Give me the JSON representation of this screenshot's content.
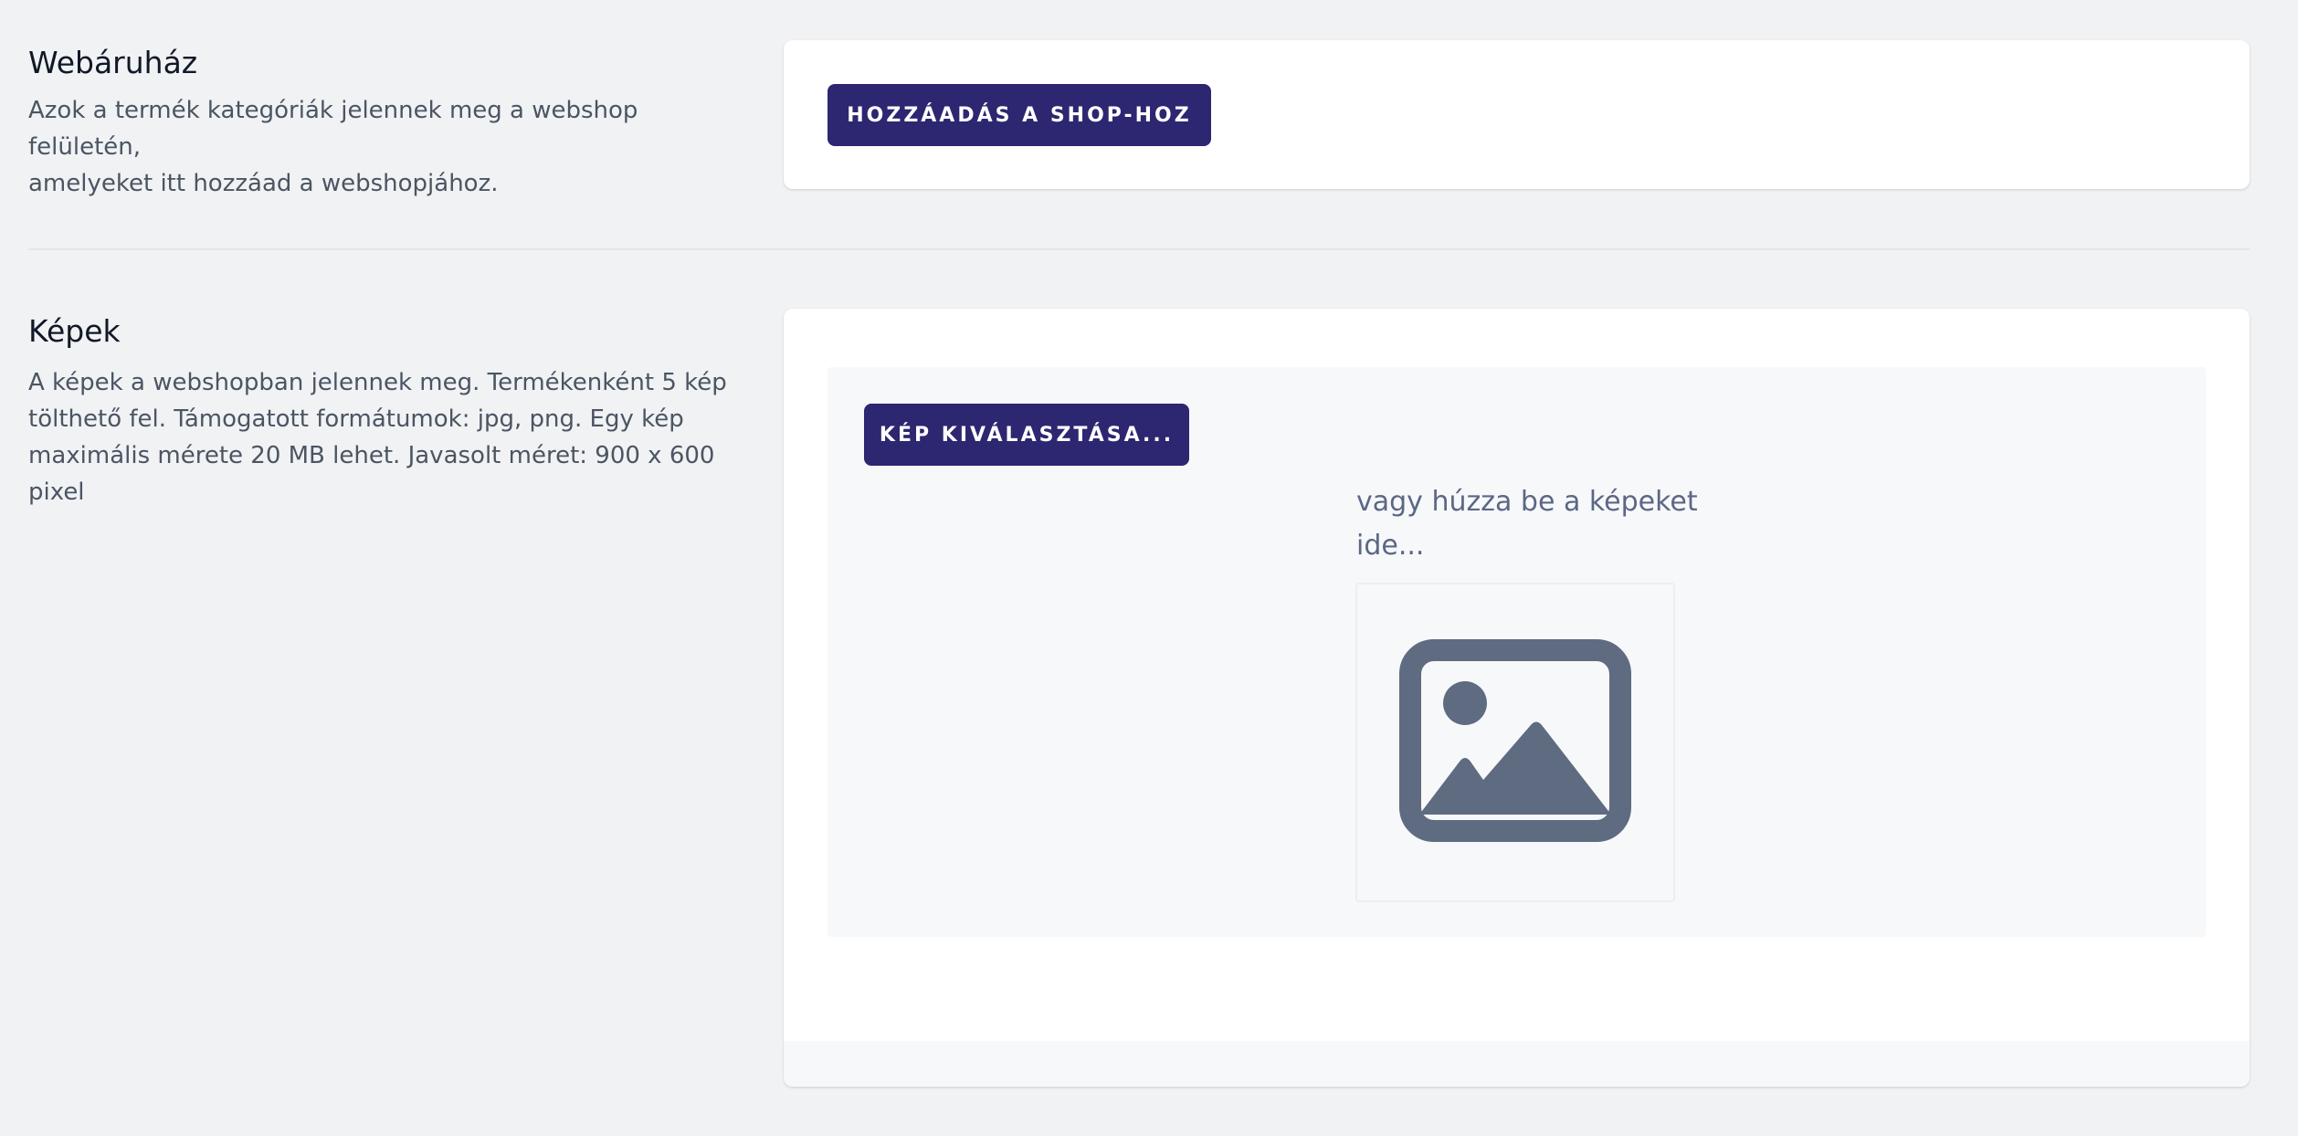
{
  "webshop": {
    "title": "Webáruház",
    "description_line1": "Azok a termék kategóriák jelennek meg a webshop felületén,",
    "description_line2": "amelyeket itt hozzáad a webshopjához.",
    "add_button_label": "HOZZÁADÁS A SHOP-HOZ"
  },
  "images": {
    "title": "Képek",
    "description_line1": "A képek a webshopban jelennek meg. Termékenként 5 kép",
    "description_line2": "tölthető fel. Támogatott formátumok: jpg, png. Egy kép",
    "description_line3": "maximális mérete 20 MB lehet. Javasolt méret: 900 x 600",
    "description_line4": "pixel",
    "select_button_label": "KÉP KIVÁLASZTÁSA...",
    "drop_hint_line1": "vagy húzza be a képeket",
    "drop_hint_line2": "ide...",
    "placeholder_icon": "image-placeholder-icon"
  },
  "colors": {
    "button_bg": "#2d2671",
    "icon": "#5f6b80",
    "page_bg": "#f1f2f4"
  }
}
